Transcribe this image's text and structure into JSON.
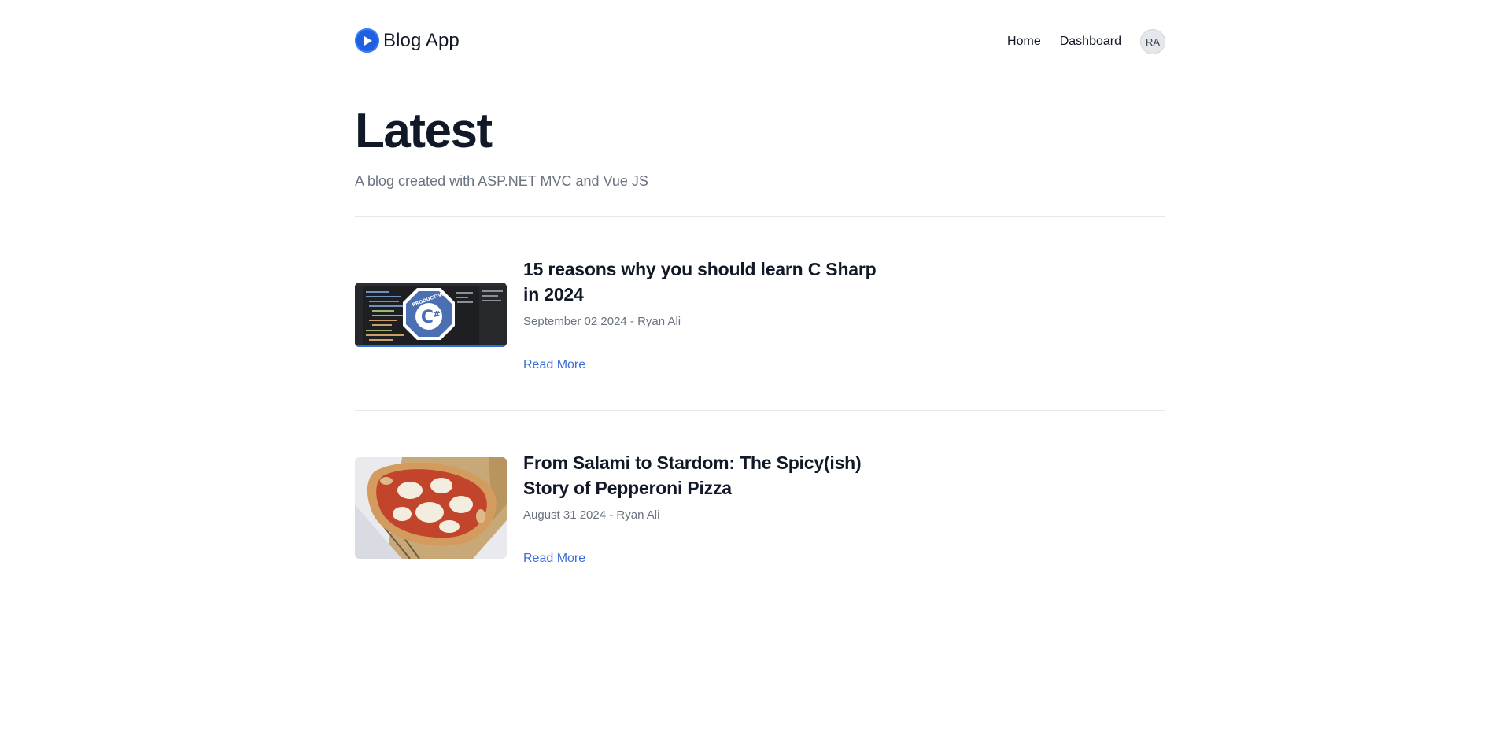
{
  "header": {
    "brand_title": "Blog App",
    "nav": {
      "home": "Home",
      "dashboard": "Dashboard"
    },
    "avatar_initials": "RA",
    "brand_color": "#1f5fe0"
  },
  "hero": {
    "title": "Latest",
    "subtitle": "A blog created with ASP.NET MVC and Vue JS"
  },
  "posts": [
    {
      "title": "15 reasons why you should learn C Sharp in 2024",
      "meta": "September 02 2024 - Ryan Ali",
      "read_more": "Read More",
      "thumbnail": "csharp-code-editor-image",
      "thumbnail_badge_text": "PRODUCTIVE C#"
    },
    {
      "title": "From Salami to Stardom: The Spicy(ish) Story of Pepperoni Pizza",
      "meta": "August 31 2024 - Ryan Ali",
      "read_more": "Read More",
      "thumbnail": "pizza-image"
    }
  ],
  "colors": {
    "link": "#3b6fd8",
    "muted_text": "#6b7280",
    "heading": "#111827",
    "divider": "#e5e7eb"
  }
}
